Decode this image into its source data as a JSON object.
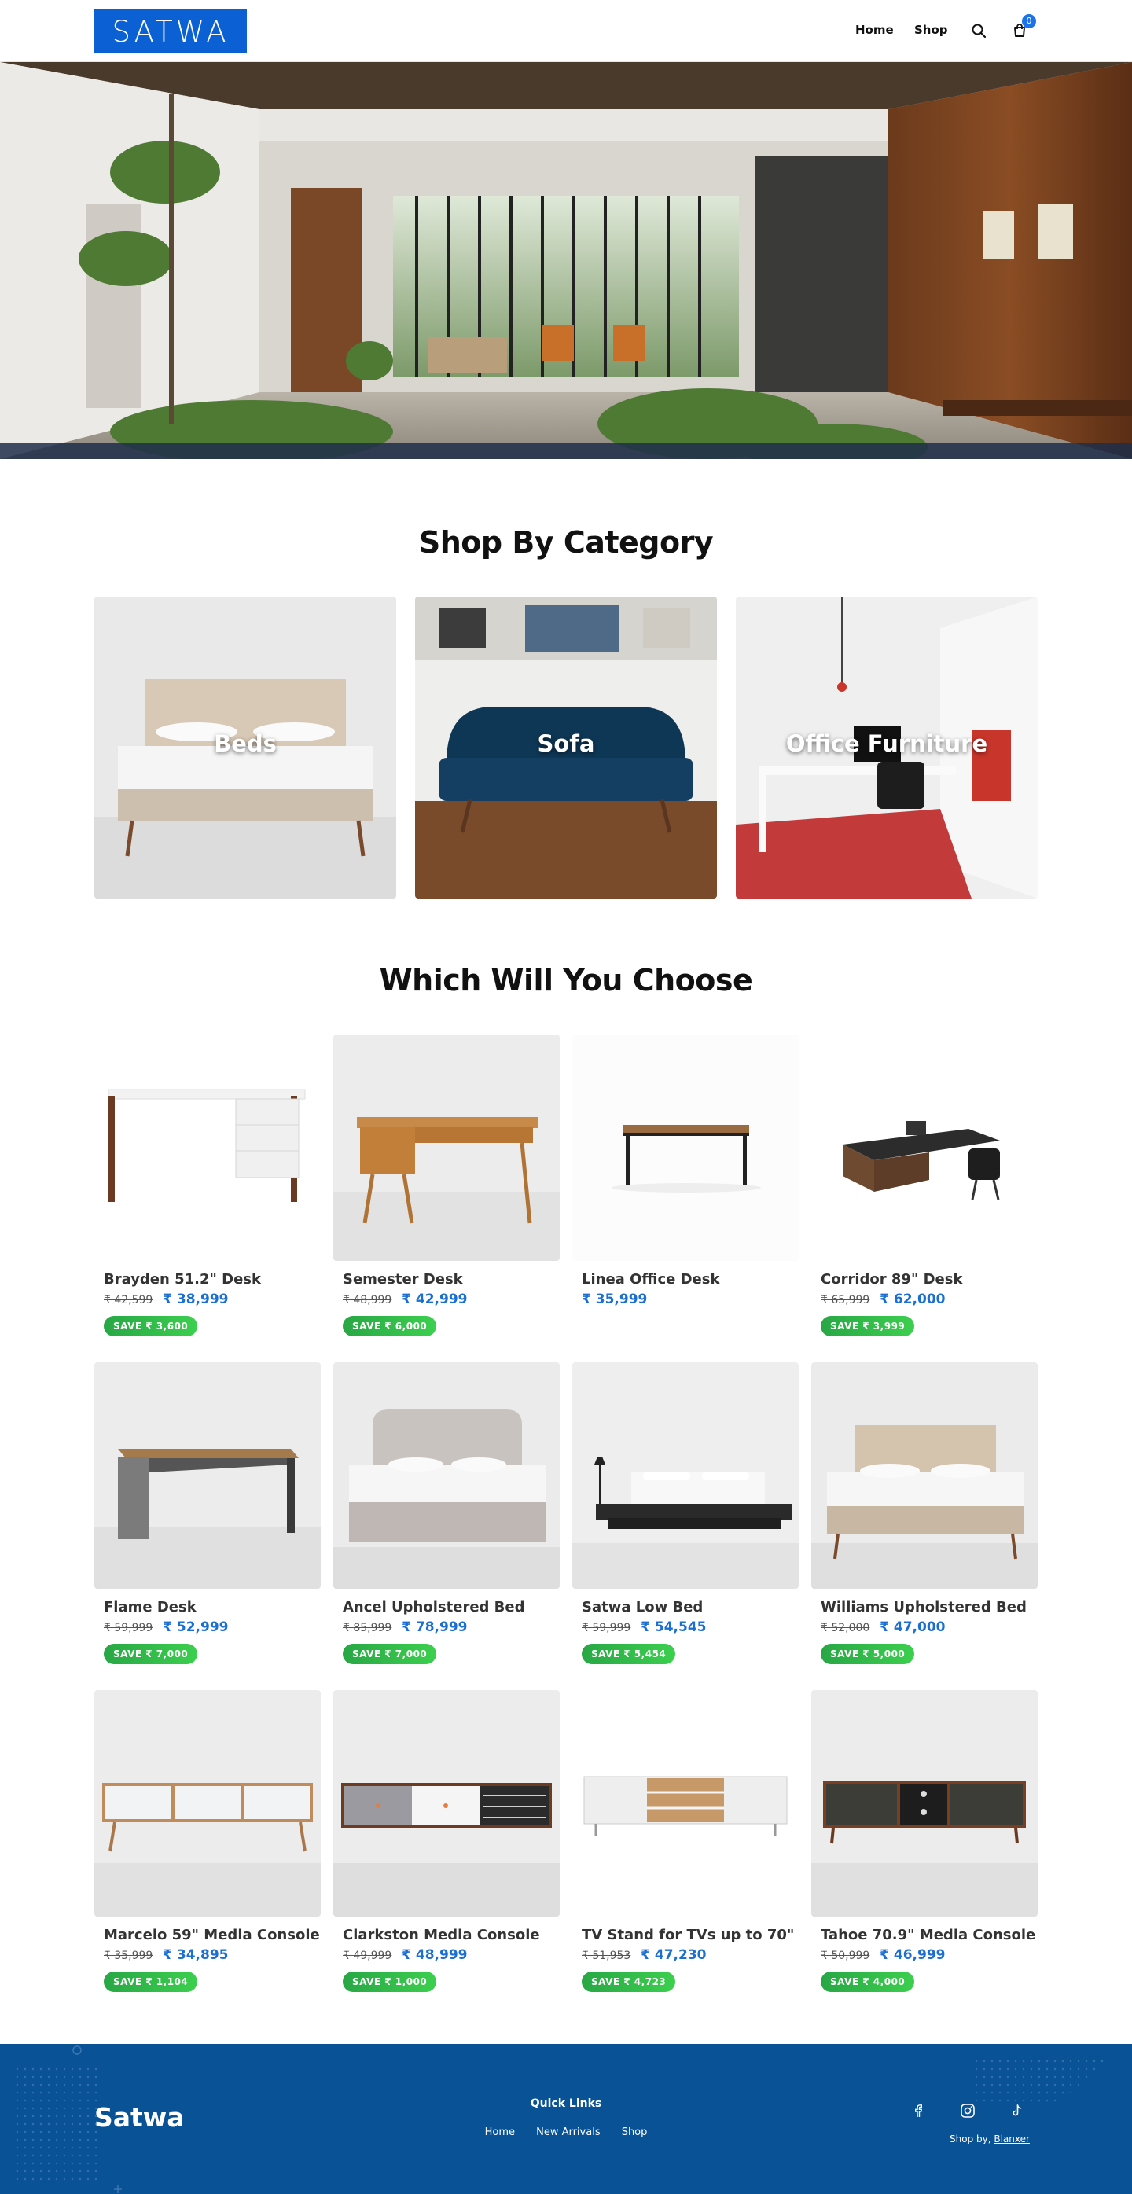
{
  "header": {
    "logo_text": "SATWA",
    "nav": [
      {
        "label": "Home"
      },
      {
        "label": "Shop"
      }
    ],
    "cart_count": "0",
    "brand_color": "#0b61d4"
  },
  "categories": {
    "title": "Shop By Category",
    "items": [
      {
        "label": "Beds"
      },
      {
        "label": "Sofa"
      },
      {
        "label": "Office Furniture"
      }
    ]
  },
  "products": {
    "title": "Which Will You Choose",
    "items": [
      {
        "name": "Brayden 51.2\" Desk",
        "old": "₹ 42,599",
        "new": "₹ 38,999",
        "save": "SAVE ₹ 3,600"
      },
      {
        "name": "Semester Desk",
        "old": "₹ 48,999",
        "new": "₹ 42,999",
        "save": "SAVE ₹ 6,000"
      },
      {
        "name": "Linea Office Desk",
        "old": "",
        "new": "₹ 35,999",
        "save": ""
      },
      {
        "name": "Corridor 89\" Desk",
        "old": "₹ 65,999",
        "new": "₹ 62,000",
        "save": "SAVE ₹ 3,999"
      },
      {
        "name": "Flame Desk",
        "old": "₹ 59,999",
        "new": "₹ 52,999",
        "save": "SAVE ₹ 7,000"
      },
      {
        "name": "Ancel Upholstered Bed",
        "old": "₹ 85,999",
        "new": "₹ 78,999",
        "save": "SAVE ₹ 7,000"
      },
      {
        "name": "Satwa Low Bed",
        "old": "₹ 59,999",
        "new": "₹ 54,545",
        "save": "SAVE ₹ 5,454"
      },
      {
        "name": "Williams Upholstered Bed",
        "old": "₹ 52,000",
        "new": "₹ 47,000",
        "save": "SAVE ₹ 5,000"
      },
      {
        "name": "Marcelo 59\" Media Console",
        "old": "₹ 35,999",
        "new": "₹ 34,895",
        "save": "SAVE ₹ 1,104"
      },
      {
        "name": "Clarkston Media Console",
        "old": "₹ 49,999",
        "new": "₹ 48,999",
        "save": "SAVE ₹ 1,000"
      },
      {
        "name": "TV Stand for TVs up to 70\"",
        "old": "₹ 51,953",
        "new": "₹ 47,230",
        "save": "SAVE ₹ 4,723"
      },
      {
        "name": "Tahoe 70.9\" Media Console",
        "old": "₹ 50,999",
        "new": "₹ 46,999",
        "save": "SAVE ₹ 4,000"
      }
    ]
  },
  "footer": {
    "brand": "Satwa",
    "quick_links_title": "Quick Links",
    "quick_links": [
      {
        "label": "Home"
      },
      {
        "label": "New Arrivals"
      },
      {
        "label": "Shop"
      }
    ],
    "shop_by_prefix": "Shop by,",
    "shop_by_link": "Blanxer",
    "social_icons": [
      "facebook-icon",
      "instagram-icon",
      "tiktok-icon"
    ],
    "bg_color": "#0a5296"
  },
  "colors": {
    "accent": "#1a6fd1",
    "save_badge": "#28a745"
  }
}
